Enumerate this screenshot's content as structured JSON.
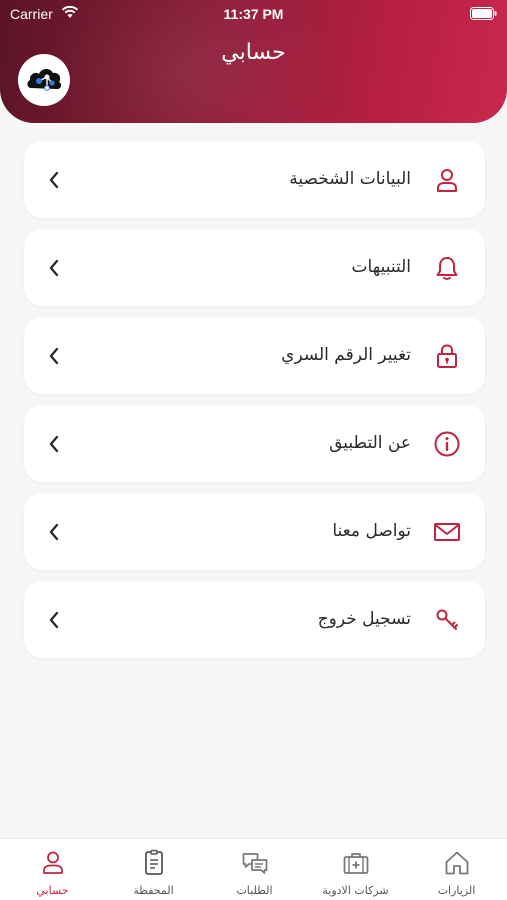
{
  "status_bar": {
    "carrier": "Carrier",
    "time": "11:37 PM"
  },
  "header": {
    "title": "حسابي"
  },
  "colors": {
    "accent": "#c0243f",
    "header_dark": "#5a1426",
    "header_light": "#c9284c"
  },
  "menu": {
    "items": [
      {
        "label": "البيانات الشخصية",
        "icon": "user-icon"
      },
      {
        "label": "التنبيهات",
        "icon": "bell-icon"
      },
      {
        "label": "تغيير الرقم السري",
        "icon": "lock-icon"
      },
      {
        "label": "عن التطبيق",
        "icon": "info-icon"
      },
      {
        "label": "تواصل معنا",
        "icon": "mail-icon"
      },
      {
        "label": "تسجيل خروج",
        "icon": "key-icon"
      }
    ]
  },
  "tabbar": {
    "tabs": [
      {
        "label": "حسابي",
        "icon": "user-icon",
        "active": true
      },
      {
        "label": "المحفظة",
        "icon": "wallet-icon",
        "active": false
      },
      {
        "label": "الطلبات",
        "icon": "chat-icon",
        "active": false
      },
      {
        "label": "شركات الادوية",
        "icon": "medkit-icon",
        "active": false
      },
      {
        "label": "الزيارات",
        "icon": "home-icon",
        "active": false
      }
    ]
  }
}
